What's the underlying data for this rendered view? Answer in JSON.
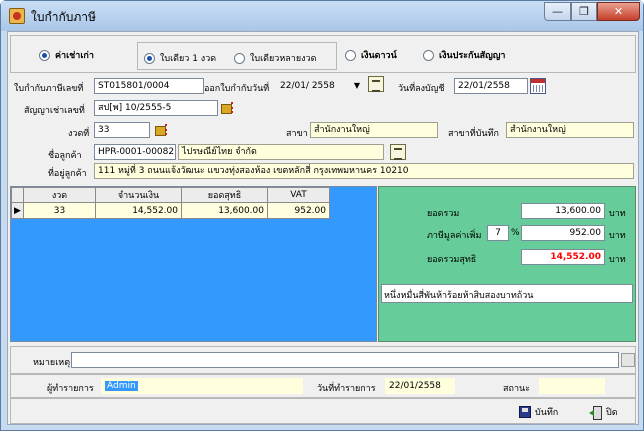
{
  "window": {
    "title": "ใบกำกับภาษี",
    "min_label": "—",
    "max_label": "❐",
    "close_label": "✕"
  },
  "mode": {
    "options": [
      "ค่าเช่าเก่า",
      "เงินดาวน์",
      "เงินประกันสัญญา"
    ],
    "selected": "ค่าเช่าเก่า",
    "sub_options": [
      "ใบเดียว 1 งวด",
      "ใบเดียวหลายงวด"
    ],
    "sub_selected": "ใบเดียว 1 งวด"
  },
  "header": {
    "invoice_no_label": "ใบกำกับภาษีเลขที่",
    "invoice_no": "ST015801/0004",
    "issue_date_label": "ออกใบกำกับวันที่",
    "issue_date": "22/01/ 2558",
    "account_date_label": "วันที่ลงบัญชี",
    "account_date": "22/01/2558",
    "contract_label": "สัญญาเช่าเลขที่",
    "contract_no": "สป[พ] 10/2555-5",
    "installment_label": "งวดที่",
    "installment": "33",
    "branch_label": "สาขา",
    "branch": "สำนักงานใหญ่",
    "record_branch_label": "สาขาที่บันทึก",
    "record_branch": "สำนักงานใหญ่",
    "customer_label": "ชื่อลูกค้า",
    "customer_code": "HPR-0001-00082",
    "customer_name": "ไปรษณีย์ไทย จำกัด",
    "address_label": "ที่อยู่ลูกค้า",
    "address": "111 หมู่ที่ 3 ถนนแจ้งวัฒนะ แขวงทุ่งสองห้อง เขตหลักสี่ กรุงเทพมหานคร 10210"
  },
  "grid": {
    "columns": [
      "งวด",
      "จำนวนเงิน",
      "ยอดสุทธิ",
      "VAT"
    ],
    "rows": [
      {
        "installment": "33",
        "amount": "14,552.00",
        "net": "13,600.00",
        "vat": "952.00"
      }
    ]
  },
  "summary": {
    "total_label": "ยอดรวม",
    "total": "13,600.00",
    "vat_label": "ภาษีมูลค่าเพิ่ม",
    "vat_rate": "7",
    "percent": "%",
    "vat": "952.00",
    "grand_label": "ยอดรวมสุทธิ",
    "grand_total": "14,552.00",
    "currency": "บาท",
    "in_words": "หนึ่งหมื่นสี่พันห้าร้อยห้าสิบสองบาทถ้วน",
    "grand_color": "#ff0000"
  },
  "footer": {
    "note_label": "หมายเหตุ",
    "note_value": "",
    "user_label": "ผู้ทำรายการ",
    "user": "Admin",
    "txn_date_label": "วันที่ทำรายการ",
    "txn_date": "22/01/2558",
    "status_label": "สถานะ",
    "status": "",
    "save_label": "บันทึก",
    "close_label": "ปิด"
  },
  "colors": {
    "grid_bg": "#3399ff",
    "summary_bg": "#66cc99",
    "readonly_bg": "#ffffde"
  }
}
